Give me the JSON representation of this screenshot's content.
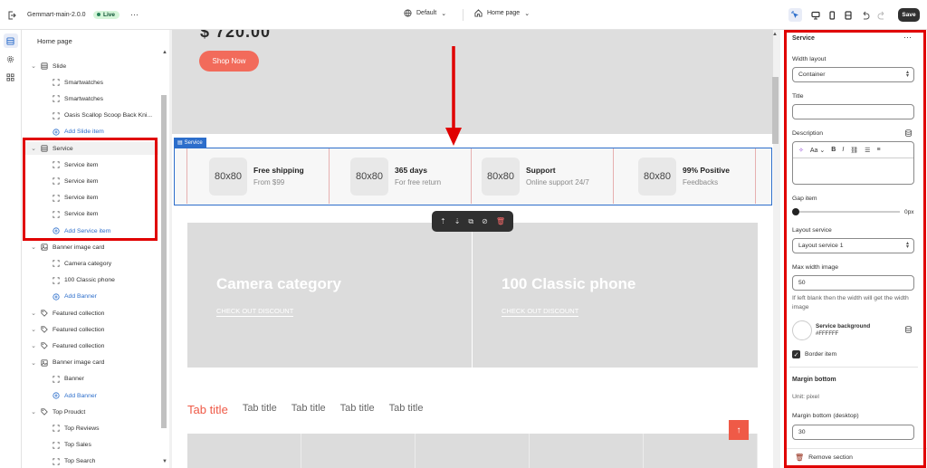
{
  "topbar": {
    "store_name": "Gemmart-main-2.0.0",
    "live_badge": "Live",
    "more": "···",
    "theme_select": "Default",
    "page_select": "Home page",
    "save_label": "Save"
  },
  "tree": {
    "title": "Home page",
    "items": [
      {
        "label": "Slide",
        "level": 1,
        "icon": "section-icon"
      },
      {
        "label": "Smartwatches",
        "level": 2,
        "icon": "block-icon"
      },
      {
        "label": "Smartwatches",
        "level": 2,
        "icon": "block-icon"
      },
      {
        "label": "Oasis Scallop Scoop Back Kni...",
        "level": 2,
        "icon": "block-icon"
      },
      {
        "label": "Add Slide item",
        "level": 2,
        "icon": "plus-circle-icon",
        "add": true
      },
      {
        "label": "Service",
        "level": 1,
        "icon": "section-icon",
        "selected": true
      },
      {
        "label": "Service item",
        "level": 2,
        "icon": "block-icon"
      },
      {
        "label": "Service item",
        "level": 2,
        "icon": "block-icon"
      },
      {
        "label": "Service item",
        "level": 2,
        "icon": "block-icon"
      },
      {
        "label": "Service item",
        "level": 2,
        "icon": "block-icon"
      },
      {
        "label": "Add Service item",
        "level": 2,
        "icon": "plus-circle-icon",
        "add": true
      },
      {
        "label": "Banner image card",
        "level": 1,
        "icon": "image-icon"
      },
      {
        "label": "Camera category",
        "level": 2,
        "icon": "block-icon"
      },
      {
        "label": "100 Classic phone",
        "level": 2,
        "icon": "block-icon"
      },
      {
        "label": "Add Banner",
        "level": 2,
        "icon": "plus-circle-icon",
        "add": true
      },
      {
        "label": "Featured collection",
        "level": 1,
        "icon": "tag-icon"
      },
      {
        "label": "Featured collection",
        "level": 1,
        "icon": "tag-icon"
      },
      {
        "label": "Featured collection",
        "level": 1,
        "icon": "tag-icon"
      },
      {
        "label": "Banner image card",
        "level": 1,
        "icon": "image-icon"
      },
      {
        "label": "Banner",
        "level": 2,
        "icon": "block-icon"
      },
      {
        "label": "Add Banner",
        "level": 2,
        "icon": "plus-circle-icon",
        "add": true
      },
      {
        "label": "Top Proudct",
        "level": 1,
        "icon": "tag-icon"
      },
      {
        "label": "Top Reviews",
        "level": 2,
        "icon": "block-icon"
      },
      {
        "label": "Top Sales",
        "level": 2,
        "icon": "block-icon"
      },
      {
        "label": "Top Search",
        "level": 2,
        "icon": "block-icon"
      }
    ]
  },
  "preview": {
    "price": "$ 720.00",
    "shop_now": "Shop Now",
    "service_tag": "Service",
    "services": [
      {
        "img": "80x80",
        "title": "Free shipping",
        "subtitle": "From $99"
      },
      {
        "img": "80x80",
        "title": "365 days",
        "subtitle": "For free return"
      },
      {
        "img": "80x80",
        "title": "Support",
        "subtitle": "Online support 24/7"
      },
      {
        "img": "80x80",
        "title": "99% Positive",
        "subtitle": "Feedbacks"
      }
    ],
    "banners": [
      {
        "title": "Camera category",
        "link": "CHECK OUT DISCOUNT"
      },
      {
        "title": "100 Classic phone",
        "link": "CHECK OUT DISCOUNT"
      }
    ],
    "tabs": [
      "Tab title",
      "Tab title",
      "Tab title",
      "Tab title",
      "Tab title"
    ]
  },
  "panel": {
    "title": "Service",
    "menu": "···",
    "width_layout_label": "Width layout",
    "width_layout_value": "Container",
    "title_label": "Title",
    "title_value": "",
    "description_label": "Description",
    "rte_font": "Aa",
    "gap_label": "Gap item",
    "gap_value": "0px",
    "gap_fraction": 0,
    "layout_service_label": "Layout service",
    "layout_service_value": "Layout service 1",
    "max_width_label": "Max width image",
    "max_width_value": "50",
    "max_width_help": "If left blank then the width will get the width image",
    "bg_label": "Service background",
    "bg_value": "#FFFFFF",
    "border_label": "Border item",
    "border_checked": true,
    "margin_heading": "Margin bottom",
    "unit_label": "Unit: pixel",
    "margin_desktop_label": "Margin bottom (desktop)",
    "margin_desktop_value": "30",
    "remove_label": "Remove section"
  },
  "colors": {
    "accent": "#2c6ecb",
    "shop_button": "#f26b5b",
    "tab_active": "#ef5a47",
    "annotation": "#e00000"
  }
}
